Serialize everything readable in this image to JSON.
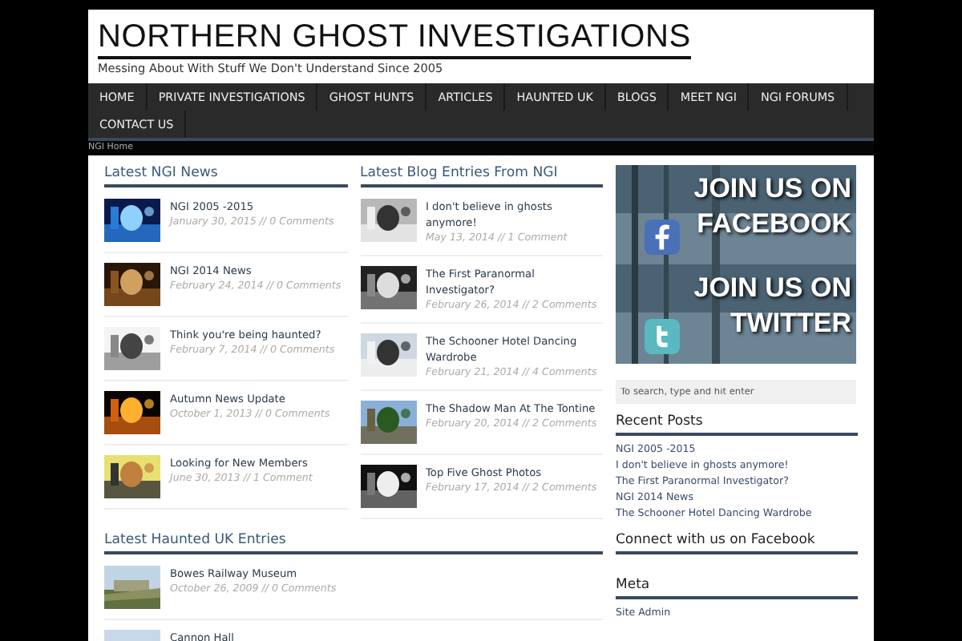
{
  "header": {
    "title": "NORTHERN GHOST INVESTIGATIONS",
    "tagline": "Messing About With Stuff We Don't Understand Since 2005"
  },
  "nav": [
    {
      "label": "HOME",
      "selected": false
    },
    {
      "label": "PRIVATE INVESTIGATIONS",
      "selected": false
    },
    {
      "label": "GHOST HUNTS",
      "selected": false
    },
    {
      "label": "ARTICLES",
      "selected": false
    },
    {
      "label": "HAUNTED UK",
      "selected": false
    },
    {
      "label": "BLOGS",
      "selected": false
    },
    {
      "label": "MEET NGI",
      "selected": false
    },
    {
      "label": "NGI FORUMS",
      "selected": false
    },
    {
      "label": "CONTACT US",
      "selected": false
    }
  ],
  "breadcrumb": "NGI Home",
  "news": {
    "heading": "Latest NGI News",
    "items": [
      {
        "title": "NGI 2005 -2015",
        "meta": "January 30, 2015 // 0 Comments"
      },
      {
        "title": "NGI 2014 News",
        "meta": "February 24, 2014 // 0 Comments"
      },
      {
        "title": "Think you're being haunted?",
        "meta": "February 7, 2014 // 0 Comments"
      },
      {
        "title": "Autumn News Update",
        "meta": "October 1, 2013 // 0 Comments"
      },
      {
        "title": "Looking for New Members",
        "meta": "June 30, 2013 // 1 Comment"
      }
    ]
  },
  "blog": {
    "heading": "Latest Blog Entries From NGI",
    "items": [
      {
        "title": "I don't believe in ghosts anymore!",
        "meta": "May 13, 2014 // 1 Comment"
      },
      {
        "title": "The First Paranormal Investigator?",
        "meta": "February 26, 2014 // 2 Comments"
      },
      {
        "title": "The Schooner Hotel Dancing Wardrobe",
        "meta": "February 21, 2014 // 4 Comments"
      },
      {
        "title": "The Shadow Man At The Tontine",
        "meta": "February 20, 2014 // 2 Comments"
      },
      {
        "title": "Top Five Ghost Photos",
        "meta": "February 17, 2014 // 2 Comments"
      }
    ]
  },
  "haunted": {
    "heading": "Latest Haunted UK Entries",
    "items": [
      {
        "title": "Bowes Railway Museum",
        "meta": "October 26, 2009 // 0 Comments"
      },
      {
        "title": "Cannon Hall"
      }
    ]
  },
  "banners": [
    {
      "kind": "facebook",
      "line1": "JOIN US ON",
      "line2": "FACEBOOK"
    },
    {
      "kind": "twitter",
      "line1": "JOIN US ON",
      "line2": "TWITTER"
    }
  ],
  "search": {
    "placeholder": "To search, type and hit enter"
  },
  "recent": {
    "heading": "Recent Posts",
    "links": [
      "NGI 2005 -2015",
      "I don't believe in ghosts anymore!",
      "The First Paranormal Investigator?",
      "NGI 2014 News",
      "The Schooner Hotel Dancing Wardrobe"
    ]
  },
  "facebook_heading": "Connect with us on Facebook",
  "meta": {
    "heading": "Meta",
    "links": [
      "Site Admin"
    ]
  }
}
